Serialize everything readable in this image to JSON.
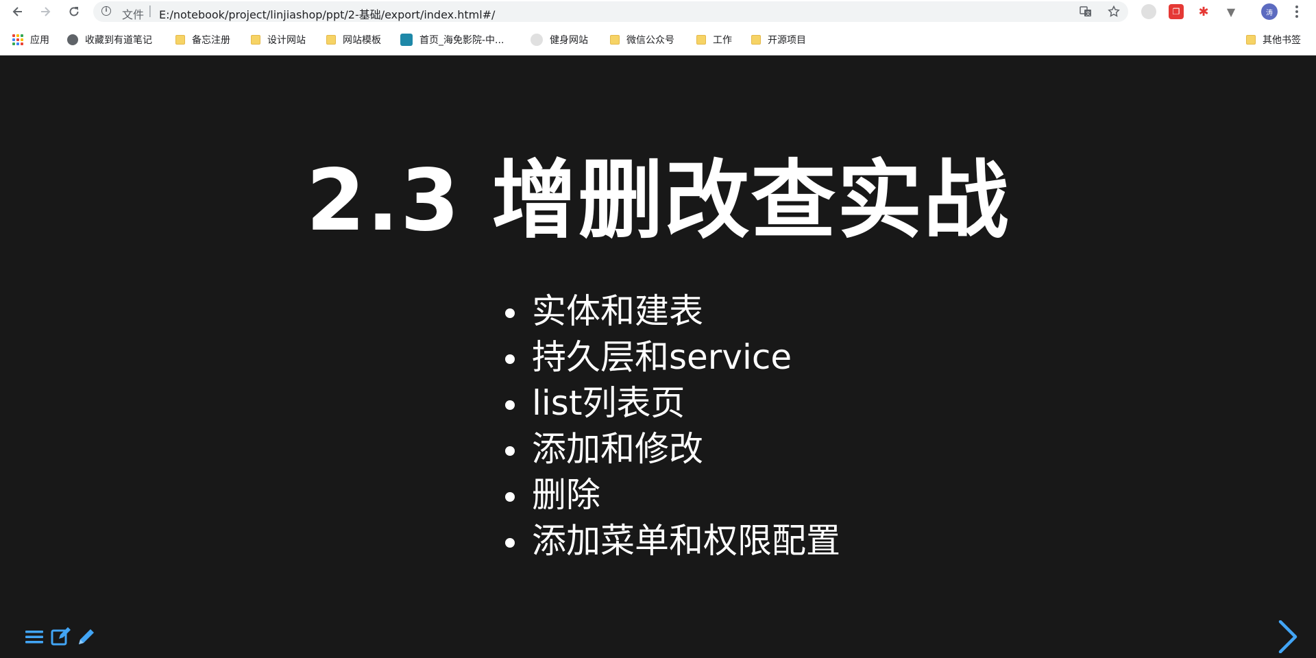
{
  "browser": {
    "url_scheme": "文件",
    "url": "E:/notebook/project/linjiashop/ppt/2-基础/export/index.html#/",
    "profile_initial": "涛"
  },
  "bookmarks": [
    {
      "label": "应用",
      "icon": "apps-grid-icon"
    },
    {
      "label": "收藏到有道笔记",
      "icon": "globe-icon"
    },
    {
      "label": "备忘注册",
      "icon": "folder-icon"
    },
    {
      "label": "设计网站",
      "icon": "folder-icon"
    },
    {
      "label": "网站模板",
      "icon": "folder-icon"
    },
    {
      "label": "首页_海免影院-中...",
      "icon": "site-icon"
    },
    {
      "label": "健身网站",
      "icon": "site-icon"
    },
    {
      "label": "微信公众号",
      "icon": "folder-icon"
    },
    {
      "label": "工作",
      "icon": "folder-icon"
    },
    {
      "label": "开源项目",
      "icon": "folder-icon"
    },
    {
      "label": "其他书签",
      "icon": "folder-icon"
    }
  ],
  "slide": {
    "title": "2.3 增删改查实战",
    "bullets": [
      "实体和建表",
      "持久层和service",
      "list列表页",
      "添加和修改",
      "删除",
      "添加菜单和权限配置"
    ]
  },
  "colors": {
    "slide_background": "#181818",
    "accent": "#42a5f5",
    "text": "#ffffff"
  }
}
